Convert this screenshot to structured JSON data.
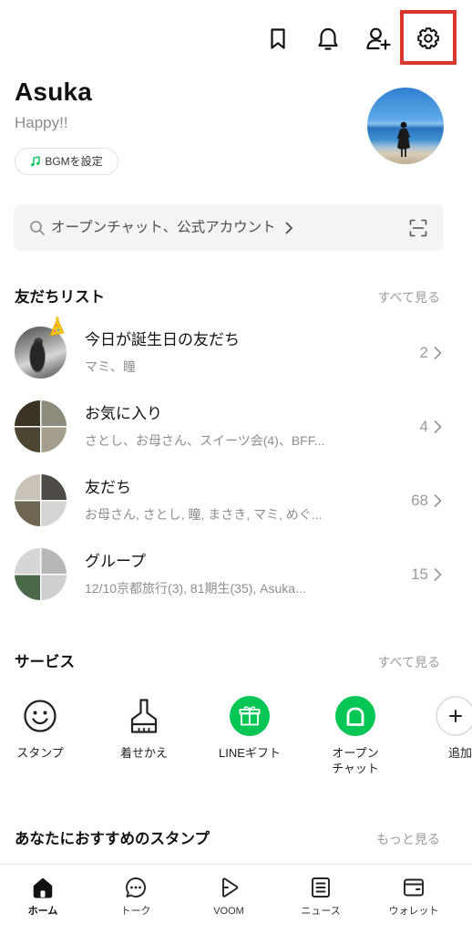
{
  "header": {
    "icons": [
      "bookmark-icon",
      "bell-icon",
      "add-friend-icon",
      "settings-icon"
    ],
    "highlighted_icon": "settings-icon"
  },
  "profile": {
    "name": "Asuka",
    "status_message": "Happy!!",
    "bgm_button_label": "BGMを設定",
    "bgm_icon": "music-note-icon"
  },
  "search": {
    "text": "オープンチャット、公式アカウント",
    "icon": "search-icon",
    "scan_icon": "scan-icon"
  },
  "friends_list": {
    "title": "友だちリスト",
    "see_all": "すべて見る",
    "items": [
      {
        "title": "今日が誕生日の友だち",
        "subtitle": "マミ、瞳",
        "count": "2"
      },
      {
        "title": "お気に入り",
        "subtitle": "さとし、お母さん、スイーツ会(4)、BFF...",
        "count": "4"
      },
      {
        "title": "友だち",
        "subtitle": "お母さん, さとし, 瞳, まさき, マミ, めぐ...",
        "count": "68"
      },
      {
        "title": "グループ",
        "subtitle": "12/10京都旅行(3), 81期生(35), Asuka...",
        "count": "15"
      }
    ]
  },
  "services": {
    "title": "サービス",
    "see_all": "すべて見る",
    "items": [
      {
        "label": "スタンプ",
        "icon": "smiley-icon"
      },
      {
        "label": "着せかえ",
        "icon": "brush-icon"
      },
      {
        "label": "LINEギフト",
        "icon": "gift-icon"
      },
      {
        "label": "オープン",
        "label_line2": "チャット",
        "icon": "open-chat-icon"
      },
      {
        "label": "追加",
        "icon": "plus-icon"
      }
    ]
  },
  "recommended_stamps": {
    "title": "あなたにおすすめのスタンプ",
    "more": "もっと見る"
  },
  "bottom_nav": {
    "items": [
      {
        "label": "ホーム",
        "icon": "home-icon",
        "active": true
      },
      {
        "label": "トーク",
        "icon": "chat-icon",
        "active": false
      },
      {
        "label": "VOOM",
        "icon": "voom-icon",
        "active": false
      },
      {
        "label": "ニュース",
        "icon": "news-icon",
        "active": false
      },
      {
        "label": "ウォレット",
        "icon": "wallet-icon",
        "active": false
      }
    ]
  },
  "colors": {
    "text": "#111111",
    "secondary_text": "#949494",
    "line_green": "#06c755",
    "search_background": "#f3f4f6",
    "highlight_border": "#d9372b"
  }
}
